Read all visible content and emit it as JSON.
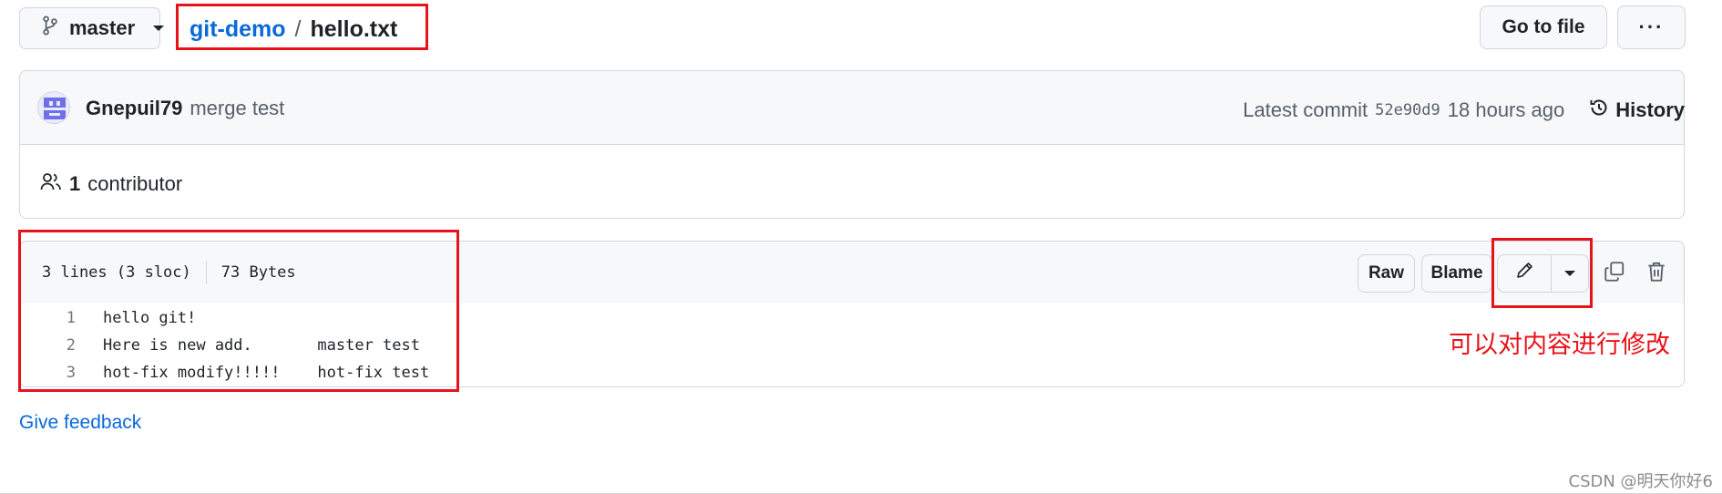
{
  "topbar": {
    "branch": "master",
    "repo": "git-demo",
    "separator": "/",
    "file": "hello.txt",
    "go_to_file": "Go to file",
    "more": "···"
  },
  "commit": {
    "author": "Gnepuil79",
    "message": "merge test",
    "latest_label": "Latest commit",
    "sha": "52e90d9",
    "time": "18 hours ago",
    "history": "History"
  },
  "contributors": {
    "count": "1",
    "label": "contributor"
  },
  "file": {
    "lines_info": "3 lines (3 sloc)",
    "size": "73 Bytes",
    "raw": "Raw",
    "blame": "Blame",
    "lines": [
      {
        "num": "1",
        "text": "hello git!"
      },
      {
        "num": "2",
        "text": "Here is new add.       master test"
      },
      {
        "num": "3",
        "text": "hot-fix modify!!!!!    hot-fix test"
      }
    ]
  },
  "annotation": "可以对内容进行修改",
  "feedback": "Give feedback",
  "watermark": "CSDN @明天你好6",
  "icons": [
    "branch-icon",
    "kebab-icon",
    "history-icon",
    "people-icon",
    "pencil-icon",
    "caret-down-icon",
    "copy-icon",
    "trash-icon"
  ],
  "colors": {
    "annotation_red": "#e6131a",
    "link_blue": "#0969da"
  }
}
